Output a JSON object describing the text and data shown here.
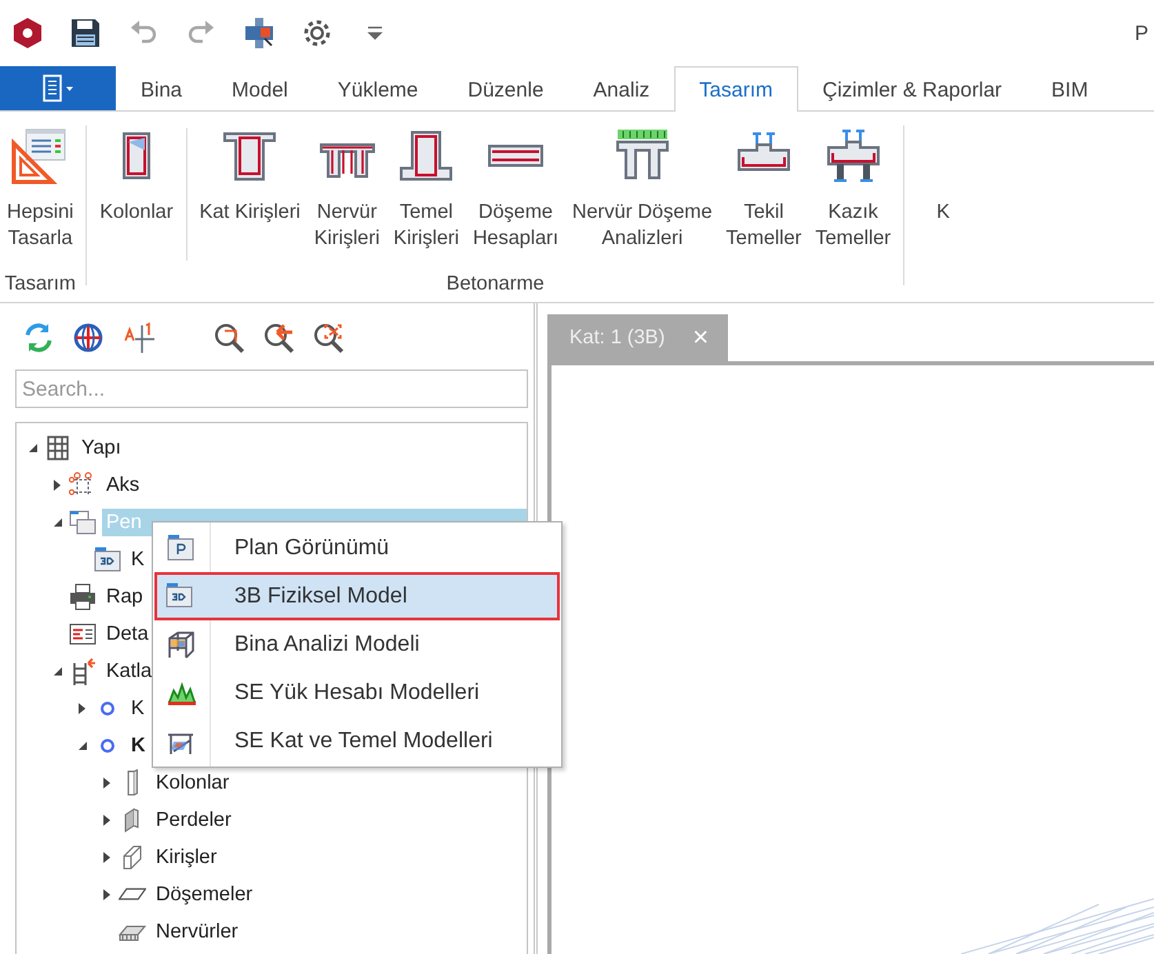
{
  "window": {
    "title": "P"
  },
  "quick_access": [
    {
      "kind": "logo"
    },
    {
      "kind": "save"
    },
    {
      "kind": "undo",
      "disabled": true
    },
    {
      "kind": "redo",
      "disabled": true
    },
    {
      "kind": "tool",
      "disabled": false
    },
    {
      "kind": "gear",
      "disabled": false
    },
    {
      "kind": "more"
    }
  ],
  "tabs": [
    {
      "label": "Bina",
      "selected": false
    },
    {
      "label": "Model",
      "selected": false
    },
    {
      "label": "Yükleme",
      "selected": false
    },
    {
      "label": "Düzenle",
      "selected": false
    },
    {
      "label": "Analiz",
      "selected": false
    },
    {
      "label": "Tasarım",
      "selected": true
    },
    {
      "label": "Çizimler & Raporlar",
      "selected": false
    },
    {
      "label": "BIM",
      "selected": false
    }
  ],
  "ribbon": {
    "groups": [
      {
        "label": "Tasarım",
        "sections": [
          [
            {
              "kind": "design-all",
              "lines": [
                "Hepsini",
                "Tasarla"
              ]
            }
          ]
        ]
      },
      {
        "label": "Betonarme",
        "sections": [
          [
            {
              "kind": "column",
              "lines": [
                "Kolonlar"
              ]
            }
          ],
          [
            {
              "kind": "beam",
              "lines": [
                "Kat Kirişleri"
              ]
            },
            {
              "kind": "rib-beam",
              "lines": [
                "Nervür",
                "Kirişleri"
              ]
            },
            {
              "kind": "footing-beam",
              "lines": [
                "Temel",
                "Kirişleri"
              ]
            },
            {
              "kind": "slab",
              "lines": [
                "Döşeme",
                "Hesapları"
              ]
            },
            {
              "kind": "rib-slab",
              "lines": [
                "Nervür Döşeme",
                "Analizleri"
              ]
            },
            {
              "kind": "footing",
              "lines": [
                "Tekil",
                "Temeller"
              ]
            },
            {
              "kind": "pile",
              "lines": [
                "Kazık",
                "Temeller"
              ]
            }
          ]
        ]
      },
      {
        "sections": [
          [
            {
              "kind": "cut",
              "lines": [
                "K"
              ]
            }
          ]
        ]
      }
    ]
  },
  "panel_toolbar": [
    {
      "kind": "refresh"
    },
    {
      "kind": "globe"
    },
    {
      "kind": "axis-label"
    },
    {
      "kind": "zoom-window"
    },
    {
      "kind": "zoom-previous"
    },
    {
      "kind": "zoom-extents"
    }
  ],
  "search": {
    "placeholder": "Search..."
  },
  "tree": [
    {
      "label": "Yapı",
      "kind": "structure",
      "expanded": true,
      "selected": false,
      "children": [
        {
          "label": "Aks",
          "kind": "axis",
          "expanded": false,
          "selected": false
        },
        {
          "label": "Pen",
          "kind": "windows",
          "expanded": true,
          "selected": true,
          "children": [
            {
              "label": "K",
              "kind": "view3d",
              "selected": false
            }
          ]
        },
        {
          "label": "Rap",
          "kind": "printer",
          "selected": false
        },
        {
          "label": "Deta",
          "kind": "detail",
          "selected": false
        },
        {
          "label": "Katla",
          "kind": "floors",
          "expanded": true,
          "selected": false,
          "children": [
            {
              "label": "K",
              "kind": "floor",
              "expanded": false,
              "selected": false,
              "current": false
            },
            {
              "label": "K",
              "kind": "floor",
              "expanded": true,
              "selected": false,
              "current": true,
              "children": [
                {
                  "label": "Kolonlar",
                  "kind": "column",
                  "expanded": false,
                  "selected": false
                },
                {
                  "label": "Perdeler",
                  "kind": "wall",
                  "expanded": false,
                  "selected": false
                },
                {
                  "label": "Kirişler",
                  "kind": "beam",
                  "expanded": false,
                  "selected": false
                },
                {
                  "label": "Döşemeler",
                  "kind": "slab",
                  "expanded": false,
                  "selected": false
                },
                {
                  "label": "Nervürler",
                  "kind": "rib",
                  "selected": false
                }
              ]
            }
          ]
        }
      ]
    }
  ],
  "context_menu": [
    {
      "label": "Plan Görünümü",
      "kind": "plan",
      "selected": false
    },
    {
      "label": "3B Fiziksel Model",
      "kind": "view3d",
      "selected": true
    },
    {
      "label": "Bina Analizi Modeli",
      "kind": "analysis",
      "selected": false
    },
    {
      "label": "SE Yük Hesabı Modelleri",
      "kind": "load",
      "selected": false
    },
    {
      "label": "SE Kat ve Temel Modelleri",
      "kind": "floor-model",
      "selected": false
    }
  ],
  "document_tabs": [
    {
      "label": "Kat: 1 (3B)",
      "close": "×",
      "selected": false
    }
  ]
}
